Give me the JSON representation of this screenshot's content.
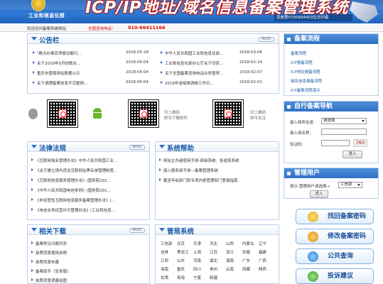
{
  "header": {
    "ministry": "工业和信息化部",
    "system_title": "ICP/IP地址/域名信息备案管理系统",
    "visitor_text": "您是第5705894403位访问者"
  },
  "subbar": {
    "welcome": "欢迎访问备案系统网站",
    "hotline_label": "全国咨询电话：",
    "hotline_number": "010-66411166"
  },
  "announcements": {
    "title": "公告栏",
    "more": "MORE",
    "left": [
      {
        "text": "\"数点办事百项便动解行...",
        "date": "2018-05-28"
      },
      {
        "text": "关于2018年5月份联合...",
        "date": "2018-05-04"
      },
      {
        "text": "重庆市管局网站数据公示",
        "date": "2018-05-04"
      },
      {
        "text": "关于调理备案信息不完整网...",
        "date": "2018-05-04"
      }
    ],
    "right": [
      {
        "text": "中华人民共和国工业和信息化部...",
        "date": "2018-03-06"
      },
      {
        "text": "工业和信息化部办公厅关于切实...",
        "date": "2018-02-24"
      },
      {
        "text": "关于全国备案咨询电话业务暂停...",
        "date": "2018-02-07"
      },
      {
        "text": "2018年省级旅游统工作日...",
        "date": "2018-02-01"
      }
    ]
  },
  "apps": {
    "captions": [
      "扫二维码\n即可下载软件",
      "扫二维码\n即可关注"
    ]
  },
  "laws": {
    "title": "法律法规",
    "more": "MORE",
    "items": [
      "《互联网域名管理办法》中华人民共和国工业...",
      "《关于建立境内违法互联网站黑名单管理制度...",
      "《互联网信息服务管理办法》(国务院292...",
      "《中华人民共和国电信条例》(国务院291...",
      "《非经营性互联网信息服务备案管理办法》(...",
      "《电信业务经营许可管理办法》(工业和信息..."
    ]
  },
  "help": {
    "title": "系统帮助",
    "items": [
      "网站主办者使用手册-部级系统、各省局系统",
      "接入服务商手册—备案管理系统",
      "截至年前部门和专项内容管理部门登录指南"
    ]
  },
  "downloads": {
    "title": "相关下载",
    "more": "MORE",
    "items": [
      "备案常见问题问答",
      "拍照背景使用说明",
      "拍照背景布幕",
      "备案助手（安卓版）",
      "拍照背景源幕绘图"
    ]
  },
  "provinces": {
    "title": "管局系统",
    "rows": [
      [
        "工信部",
        "北京",
        "天津",
        "河北",
        "山西",
        "内蒙古",
        "辽宁"
      ],
      [
        "吉林",
        "黑龙江",
        "上海",
        "江苏",
        "浙江",
        "安徽",
        "福建"
      ],
      [
        "江西",
        "山东",
        "河南",
        "湖北",
        "湖南",
        "广东",
        "广西"
      ],
      [
        "海南",
        "重庆",
        "四川",
        "贵州",
        "云南",
        "西藏",
        "陕西"
      ],
      [
        "甘肃",
        "青海",
        "宁夏",
        "新疆"
      ]
    ]
  },
  "sidebar": {
    "process_title": "备案流程",
    "process_links": [
      "备案流程",
      "ICP报备流程",
      "ICP地址报备流程",
      "域名信息报备流程",
      "ICP备案流程演示"
    ],
    "nav_title": "自行备案导航",
    "area_label": "接入商所在省:",
    "area_value": "请选择",
    "name_label": "接入商名称:",
    "captcha_label": "验证码:",
    "captcha_text": "7RG",
    "nav_submit": "进入",
    "user_title": "管理用户",
    "user_prompt": "提示:管理用户请选择→",
    "user_select": "工信部",
    "user_go": "进入",
    "buttons": [
      "找回备案密码",
      "修改备案密码",
      "公共查询",
      "投诉建议"
    ]
  },
  "colors": {
    "header_blue": "#2f7ad6",
    "accent_red": "#e00000",
    "title_blue": "#1a5ba8"
  }
}
